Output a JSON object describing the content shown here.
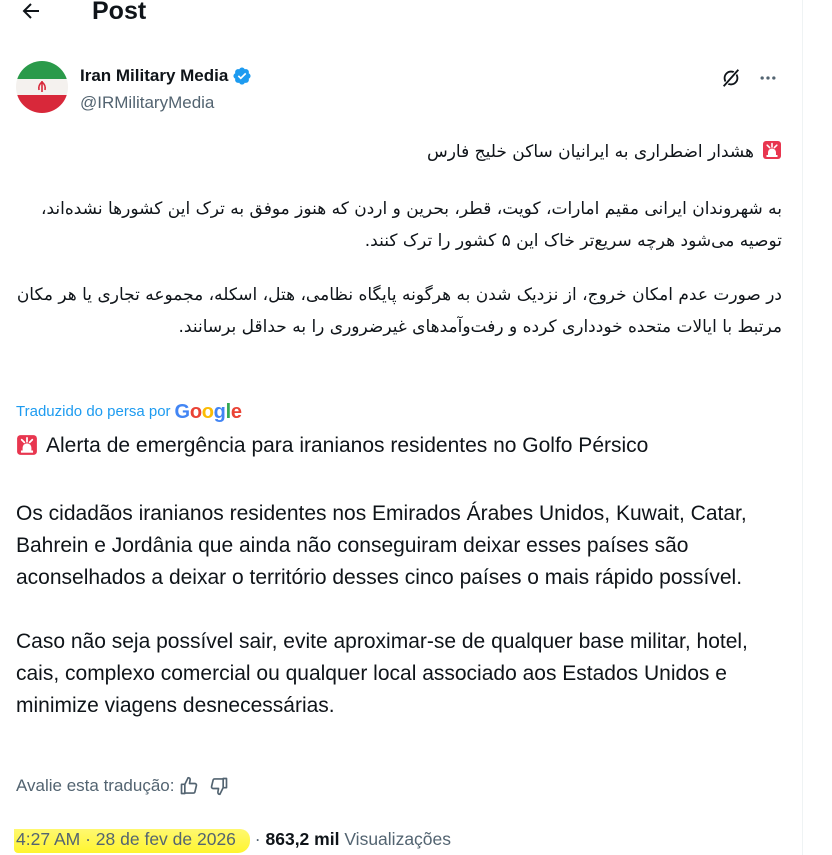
{
  "header": {
    "title": "Post"
  },
  "author": {
    "name": "Iran Military Media",
    "handle": "@IRMilitaryMedia"
  },
  "post": {
    "fa_paragraphs": [
      "هشدار اضطراری به ایرانیان ساکن خلیج فارس",
      "به شهروندان ایرانی مقیم امارات، کویت، قطر، بحرین و اردن که هنوز موفق به ترک این کشورها نشده‌اند، توصیه می‌شود هرچه سریع‌تر خاک این ۵ کشور را ترک کنند.",
      "در صورت عدم امکان خروج، از نزدیک شدن به هرگونه پایگاه نظامی، هتل، اسکله، مجموعه تجاری یا هر مکان مرتبط با ایالات متحده خودداری کرده و رفت‌وآمدهای غیرضروری را به حداقل برسانند."
    ],
    "translated_label": "Traduzido do persa por",
    "translated_provider": "Google",
    "pt_paragraphs": [
      "Alerta de emergência para iranianos residentes no Golfo Pérsico",
      "Os cidadãos iranianos residentes nos Emirados Árabes Unidos, Kuwait, Catar, Bahrein e Jordânia que ainda não conseguiram deixar esses países são aconselhados a deixar o território desses cinco países o mais rápido possível.",
      "Caso não seja possível sair, evite aproximar-se de qualquer base militar, hotel, cais, complexo comercial ou qualquer local associado aos Estados Unidos e minimize viagens desnecessárias."
    ],
    "rate_label": "Avalie esta tradução:"
  },
  "meta": {
    "time": "4:27 AM",
    "separator": "·",
    "date": "28 de fev de 2026",
    "views_count": "863,2 mil",
    "views_label": "Visualizações"
  },
  "colors": {
    "accent": "#1d9bf0",
    "secondary_text": "#536471",
    "primary_text": "#0f1419",
    "highlight": "#fff52e",
    "siren": "#e8364f"
  },
  "icons": [
    "back-arrow-icon",
    "iran-flag-avatar",
    "verified-badge-icon",
    "grok-icon",
    "more-icon",
    "siren-emoji",
    "thumbs-up-icon",
    "thumbs-down-icon",
    "google-logo"
  ]
}
